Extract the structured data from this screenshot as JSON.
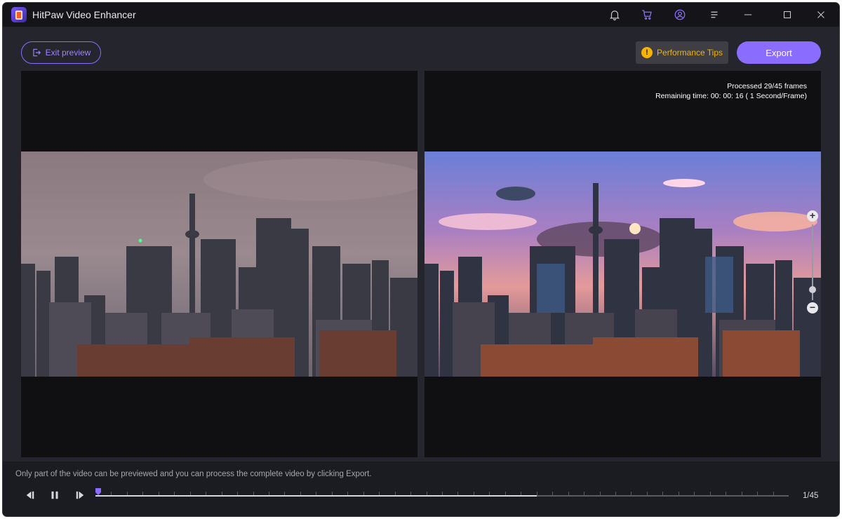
{
  "app": {
    "title": "HitPaw Video Enhancer"
  },
  "titlebar": {
    "icons": [
      "bell-icon",
      "cart-icon",
      "account-icon",
      "menu-icon",
      "minimize-icon",
      "maximize-icon",
      "close-icon"
    ]
  },
  "toolbar": {
    "exit_label": "Exit preview",
    "perf_label": "Performance Tips",
    "export_label": "Export"
  },
  "preview": {
    "processed": "Processed 29/45 frames",
    "remaining": "Remaining time: 00: 00: 16 ( 1 Second/Frame)"
  },
  "footer": {
    "hint": "Only part of the video can be previewed and you can process the complete video by clicking Export.",
    "frame_counter": "1/45",
    "timeline_progress": 0.637
  },
  "colors": {
    "accent": "#8a6cff",
    "warning": "#f4b400",
    "background": "#25252e"
  }
}
